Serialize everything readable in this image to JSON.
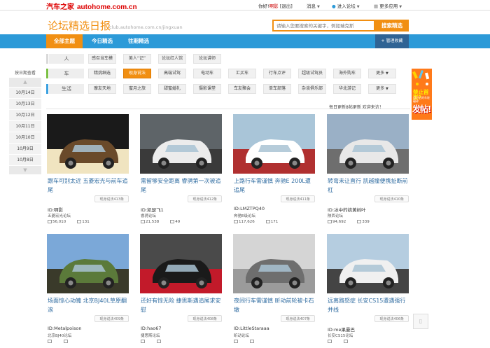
{
  "topbar": {
    "logo": "汽车之家",
    "domain": "autohome.com.cn",
    "greeting": "你好!",
    "username": "啊影",
    "logout": "[退出]",
    "messages": "消息",
    "enter_forum": "进入论坛",
    "more_apps": "更多应用"
  },
  "header": {
    "title": "论坛精选日报",
    "subtitle": "club.autohome.com.cn/jingxuan",
    "search_placeholder": "请输入您要搜索的关键字，例如瑞克斯",
    "search_button": "搜索精选"
  },
  "nav": {
    "tabs": [
      "全部主题",
      "今日精选",
      "往期精选"
    ],
    "manage": "+ 管理收藏"
  },
  "categories": [
    {
      "label": "人",
      "color": "#d9d9d9",
      "tags": [
        "感召当车模",
        "美人“记”",
        "论坛红人馆",
        "论坛讲师"
      ]
    },
    {
      "label": "车",
      "color": "#7bc043",
      "tags": [
        "精挑细选",
        "现身说法",
        "高端试驾",
        "电动车",
        "汇买车",
        "行车点评",
        "超级试驾员",
        "海外购车",
        "更多"
      ]
    },
    {
      "label": "生活",
      "color": "#3aa0e0",
      "tags": [
        "摩友天地",
        "蜜月之旅",
        "甜蜜婚礼",
        "摄影课堂",
        "车友聚会",
        "单车部落",
        "杂谈俱乐部",
        "华北游记",
        "更多"
      ]
    }
  ],
  "datelist": {
    "title": "按日期查看",
    "dates": [
      "10月14日",
      "10月13日",
      "10月12日",
      "10月11日",
      "10月10日",
      "10月9日",
      "10月8日"
    ]
  },
  "ad": {
    "line1": "禁止首页?",
    "line2": "用记忆的车轮碾碎",
    "line3": "发帖!"
  },
  "updated_text": "每日更新8帖更新 欢迎来访！",
  "cards": [
    {
      "title": "跟车可别太近 五菱宏光与前车追尾",
      "badge": "现身说法413条",
      "uid": "ID:啊影",
      "forum": "五菱宏光论坛",
      "views": "56,010",
      "replies": "131",
      "colors": [
        "#1a1a1a",
        "#6a4a2a",
        "#f0e4c0"
      ]
    },
    {
      "title": "需留够安全距离 睿骋第一次被追尾",
      "badge": "现身说法412条",
      "uid": "ID:凯瑟飞1",
      "forum": "睿骋论坛",
      "views": "21,538",
      "replies": "49",
      "colors": [
        "#5e6468",
        "#ececec",
        "#3a3a3a"
      ]
    },
    {
      "title": "上路行车需谨慎 奔驰E 200L遭追尾",
      "badge": "现身说法411条",
      "uid": "ID:LMZTPQ40",
      "forum": "奔驰E级论坛",
      "views": "117,626",
      "replies": "171",
      "colors": [
        "#a9c5d8",
        "#ffffff",
        "#b03030"
      ]
    },
    {
      "title": "转弯未让直行 凯越撞便携扯断前杠",
      "badge": "现身说法410条",
      "uid": "ID:冰中的拮黄树叶",
      "forum": "陕西论坛",
      "views": "94,692",
      "replies": "339",
      "colors": [
        "#9ab0c6",
        "#e8e8e8",
        "#6e6e6e"
      ]
    },
    {
      "title": "场面惊心动魄 北京BJ40L草原翻滚",
      "badge": "现身说法409条",
      "uid": "ID:Metalpoison",
      "forum": "北京BJ40论坛",
      "views": "",
      "replies": "",
      "colors": [
        "#7ba8d8",
        "#5b7a3a",
        "#3a3a2a"
      ]
    },
    {
      "title": "还好有惊无险 捷思斯遇追尾求安慰",
      "badge": "现身说法408条",
      "uid": "ID:hao67",
      "forum": "捷思斯论坛",
      "views": "",
      "replies": "",
      "colors": [
        "#4a4a4a",
        "#1a1a1a",
        "#c21a2a"
      ]
    },
    {
      "title": "夜间行车需谨慎 昕动前轮被卡石墩",
      "badge": "现身说法407条",
      "uid": "ID:LittleStaraaa",
      "forum": "昕动论坛",
      "views": "",
      "replies": "",
      "colors": [
        "#d5d5d5",
        "#6e6e6e",
        "#9b9b9b"
      ]
    },
    {
      "title": "远离路怒症 长安CS15遭遇强行并线",
      "badge": "现身说法406条",
      "uid": "ID:me果曼巴",
      "forum": "长安CS15论坛",
      "views": "",
      "replies": "",
      "colors": [
        "#b5cde0",
        "#f0f0f0",
        "#444444"
      ]
    }
  ]
}
